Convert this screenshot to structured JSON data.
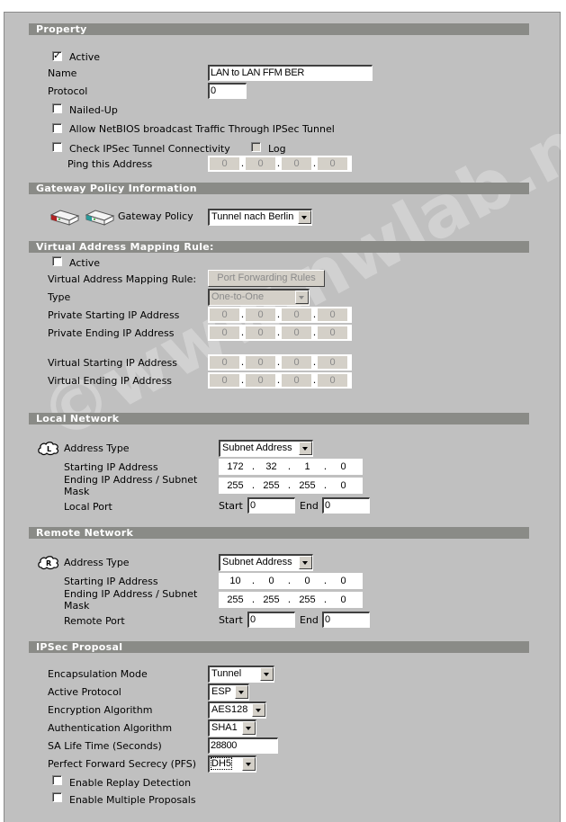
{
  "watermark": "©www.nwlab.net",
  "property": {
    "header": "Property",
    "active_label": "Active",
    "active_checked": true,
    "name_label": "Name",
    "name_value": "LAN to LAN FFM BER",
    "protocol_label": "Protocol",
    "protocol_value": "0",
    "nailed_up_label": "Nailed-Up",
    "nailed_up_checked": false,
    "netbios_label": "Allow NetBIOS broadcast Traffic Through IPSec Tunnel",
    "netbios_checked": false,
    "check_connectivity_label": "Check IPSec Tunnel Connectivity",
    "check_connectivity_checked": false,
    "log_label": "Log",
    "log_checked": false,
    "ping_label": "Ping this Address",
    "ping_ip": [
      "0",
      "0",
      "0",
      "0"
    ]
  },
  "gateway": {
    "header": "Gateway Policy Information",
    "label": "Gateway Policy",
    "value": "Tunnel nach Berlin",
    "icons": [
      "gateway-local-router-icon",
      "gateway-remote-router-icon"
    ]
  },
  "vam": {
    "header": "Virtual Address Mapping Rule:",
    "active_label": "Active",
    "active_checked": false,
    "rule_label": "Virtual Address Mapping Rule:",
    "rule_button": "Port Forwarding Rules",
    "type_label": "Type",
    "type_value": "One-to-One",
    "private_start_label": "Private Starting IP Address",
    "private_start_ip": [
      "0",
      "0",
      "0",
      "0"
    ],
    "private_end_label": "Private Ending IP Address",
    "private_end_ip": [
      "0",
      "0",
      "0",
      "0"
    ],
    "virtual_start_label": "Virtual Starting IP Address",
    "virtual_start_ip": [
      "0",
      "0",
      "0",
      "0"
    ],
    "virtual_end_label": "Virtual Ending IP Address",
    "virtual_end_ip": [
      "0",
      "0",
      "0",
      "0"
    ]
  },
  "local": {
    "header": "Local Network",
    "address_type_label": "Address Type",
    "address_type_value": "Subnet Address",
    "icon": "local-cloud-icon",
    "start_label": "Starting IP Address",
    "start_ip": [
      "172",
      "32",
      "1",
      "0"
    ],
    "end_label_line1": "Ending IP Address / Subnet",
    "end_label_line2": "Mask",
    "end_ip": [
      "255",
      "255",
      "255",
      "0"
    ],
    "port_label": "Local Port",
    "start_port_label": "Start",
    "start_port_value": "0",
    "end_port_label": "End",
    "end_port_value": "0"
  },
  "remote": {
    "header": "Remote Network",
    "address_type_label": "Address Type",
    "address_type_value": "Subnet Address",
    "icon": "remote-cloud-icon",
    "start_label": "Starting IP Address",
    "start_ip": [
      "10",
      "0",
      "0",
      "0"
    ],
    "end_label_line1": "Ending IP Address / Subnet",
    "end_label_line2": "Mask",
    "end_ip": [
      "255",
      "255",
      "255",
      "0"
    ],
    "port_label": "Remote Port",
    "start_port_label": "Start",
    "start_port_value": "0",
    "end_port_label": "End",
    "end_port_value": "0"
  },
  "ipsec": {
    "header": "IPSec Proposal",
    "encapsulation_label": "Encapsulation Mode",
    "encapsulation_value": "Tunnel",
    "protocol_label": "Active Protocol",
    "protocol_value": "ESP",
    "encryption_label": "Encryption Algorithm",
    "encryption_value": "AES128",
    "auth_label": "Authentication Algorithm",
    "auth_value": "SHA1",
    "lifetime_label": "SA Life Time (Seconds)",
    "lifetime_value": "28800",
    "pfs_label": "Perfect Forward Secrecy (PFS)",
    "pfs_value": "DH5",
    "replay_label": "Enable Replay Detection",
    "replay_checked": false,
    "multiple_label": "Enable Multiple Proposals",
    "multiple_checked": false
  }
}
